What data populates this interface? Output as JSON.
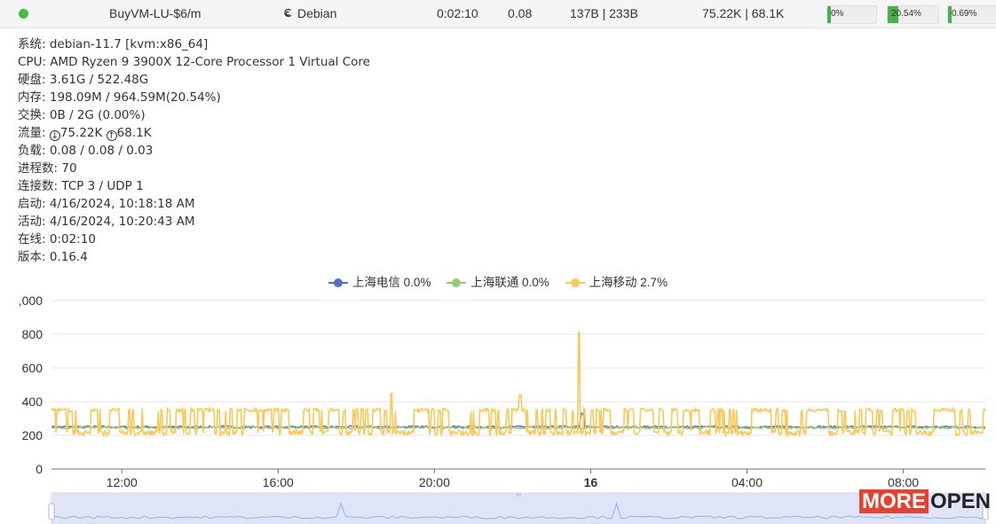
{
  "server": {
    "status_color": "#3fbf3f",
    "name": "BuyVM-LU-$6/m",
    "os": "Debian",
    "os_icon": "debian-icon",
    "uptime": "0:02:10",
    "load": "0.08",
    "network_speed": "137B | 233B",
    "traffic": "75.22K | 68.1K",
    "cpu_label": "0%",
    "cpu_pct": 0,
    "mem_label": "20.54%",
    "mem_pct": 20.54,
    "disk_label": "0.69%",
    "disk_pct": 0.69
  },
  "details": [
    {
      "label": "系统:",
      "value": "debian-11.7 [kvm:x86_64]"
    },
    {
      "label": "CPU:",
      "value": "AMD Ryzen 9 3900X 12-Core Processor 1 Virtual Core"
    },
    {
      "label": "硬盘:",
      "value": "3.61G / 522.48G"
    },
    {
      "label": "内存:",
      "value": "198.09M / 964.59M(20.54%)"
    },
    {
      "label": "交换:",
      "value": "0B / 2G (0.00%)"
    },
    {
      "label": "流量:",
      "down": "75.22K",
      "up": "68.1K"
    },
    {
      "label": "负载:",
      "value": "0.08 / 0.08 / 0.03"
    },
    {
      "label": "进程数:",
      "value": "70"
    },
    {
      "label": "连接数:",
      "value": "TCP 3 / UDP 1"
    },
    {
      "label": "启动:",
      "value": "4/16/2024, 10:18:18 AM"
    },
    {
      "label": "活动:",
      "value": "4/16/2024, 10:20:43 AM"
    },
    {
      "label": "在线:",
      "value": "0:02:10"
    },
    {
      "label": "版本:",
      "value": "0.16.4"
    }
  ],
  "chart_data": {
    "type": "line",
    "title": "",
    "xlabel": "",
    "ylabel": "",
    "ylim": [
      0,
      1000
    ],
    "yticks": [
      ",000",
      "800",
      "600",
      "400",
      "200",
      "0"
    ],
    "ytick_values": [
      1000,
      800,
      600,
      400,
      200,
      0
    ],
    "xticks": [
      {
        "label": "12:00",
        "hour": 12,
        "bold": false
      },
      {
        "label": "16:00",
        "hour": 16,
        "bold": false
      },
      {
        "label": "20:00",
        "hour": 20,
        "bold": false
      },
      {
        "label": "16",
        "hour": 24,
        "bold": true
      },
      {
        "label": "04:00",
        "hour": 28,
        "bold": false
      },
      {
        "label": "08:00",
        "hour": 32,
        "bold": false
      }
    ],
    "xrange_hours": [
      10.2,
      34.1
    ],
    "grid": true,
    "legend_position": "top-center",
    "series": [
      {
        "name": "上海电信",
        "stat": "0.0%",
        "color": "#5470c6",
        "values_desc": "baseline",
        "base": 250,
        "spike_hour": 23.8,
        "spike": 330
      },
      {
        "name": "上海联通",
        "stat": "0.0%",
        "color": "#91cc75",
        "base": 245
      },
      {
        "name": "上海移动",
        "stat": "2.7%",
        "color": "#fac858",
        "base_low": 200,
        "base_high": 350,
        "spikes": [
          [
            18.9,
            450
          ],
          [
            22.2,
            440
          ],
          [
            23.7,
            810
          ]
        ]
      }
    ]
  },
  "watermark": {
    "part1": "MORE",
    "part2": "OPEN"
  }
}
